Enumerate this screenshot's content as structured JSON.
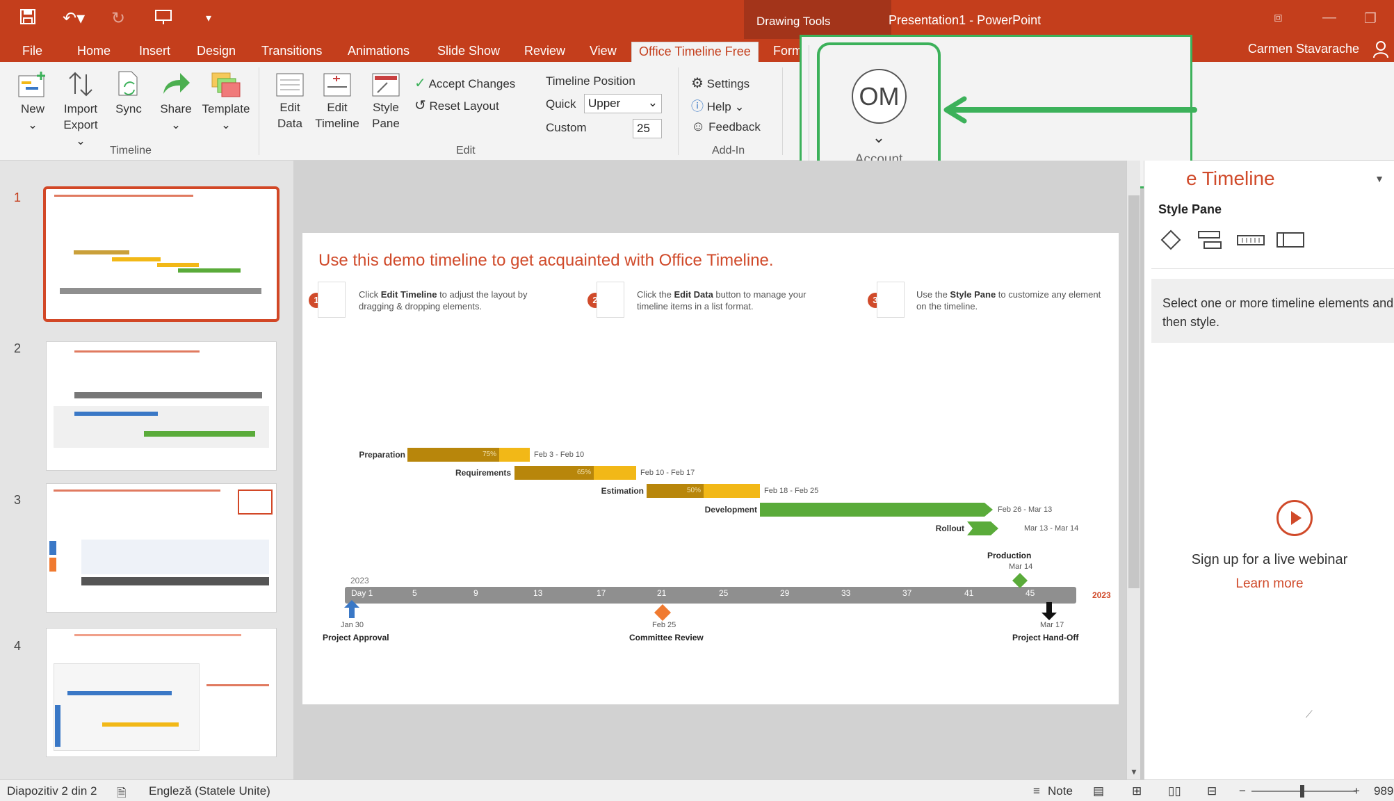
{
  "window": {
    "context_tab": "Drawing Tools",
    "title": "Presentation1 - PowerPoint"
  },
  "tabs": [
    "File",
    "Home",
    "Insert",
    "Design",
    "Transitions",
    "Animations",
    "Slide Show",
    "Review",
    "View",
    "Office Timeline Free",
    "Form"
  ],
  "user": {
    "name": "Carmen Stavarache",
    "initials": "OM",
    "account_label": "Account"
  },
  "ribbon": {
    "timeline_group": {
      "label": "Timeline",
      "new": "New",
      "import": "Import",
      "export": "Export",
      "sync": "Sync",
      "share": "Share",
      "template": "Template"
    },
    "edit_group": {
      "label": "Edit",
      "edit_data_1": "Edit",
      "edit_data_2": "Data",
      "edit_timeline_1": "Edit",
      "edit_timeline_2": "Timeline",
      "style_pane_1": "Style",
      "style_pane_2": "Pane",
      "accept": "Accept Changes",
      "reset": "Reset Layout",
      "timeline_position": "Timeline Position",
      "quick": "Quick",
      "quick_value": "Upper",
      "custom": "Custom",
      "custom_value": "25"
    },
    "addin_group": {
      "label": "Add-In",
      "settings": "Settings",
      "help": "Help",
      "feedback": "Feedback"
    }
  },
  "thumbnails": [
    "1",
    "2",
    "3",
    "4"
  ],
  "slide": {
    "title": "Use this demo timeline to get acquainted with Office Timeline.",
    "steps": [
      {
        "num": "1",
        "pre": "Click ",
        "bold": "Edit Timeline",
        "post": " to adjust the layout by dragging & dropping elements."
      },
      {
        "num": "2",
        "pre": "Click the ",
        "bold": "Edit Data",
        "post": " button to manage your timeline items in a list format."
      },
      {
        "num": "3",
        "pre": "Use the ",
        "bold": "Style Pane",
        "post": " to customize any element on the timeline."
      }
    ],
    "tasks": [
      {
        "name": "Preparation",
        "dates": "Feb 3 - Feb 10",
        "pct": "75%"
      },
      {
        "name": "Requirements",
        "dates": "Feb 10 - Feb 17",
        "pct": "65%"
      },
      {
        "name": "Estimation",
        "dates": "Feb 18 - Feb 25",
        "pct": "50%"
      },
      {
        "name": "Development",
        "dates": "Feb 26 - Mar 13"
      },
      {
        "name": "Rollout",
        "dates": "Mar 13 - Mar 14"
      }
    ],
    "timeline": {
      "year_start": "2023",
      "year_end": "2023",
      "ticks": [
        "Day 1",
        "5",
        "9",
        "13",
        "17",
        "21",
        "25",
        "29",
        "33",
        "37",
        "41",
        "45"
      ]
    },
    "milestones": [
      {
        "name": "Project Approval",
        "date": "Jan 30",
        "color": "#3a78c6"
      },
      {
        "name": "Committee Review",
        "date": "Feb 25",
        "color": "#f07a30"
      },
      {
        "name": "Project Hand-Off",
        "date": "Mar 17",
        "color": "#111111"
      },
      {
        "name": "Production",
        "date": "Mar 14",
        "color": "#5aab3a"
      }
    ]
  },
  "pane": {
    "title": "e Timeline",
    "style_pane": "Style Pane",
    "message": "Select one or more timeline elements and then style.",
    "webinar": "Sign up for a live webinar",
    "learn_more": "Learn more"
  },
  "status": {
    "slide_info": "Diapozitiv 2 din 2",
    "language": "Engleză (Statele Unite)",
    "notes": "Note",
    "zoom": "989"
  },
  "colors": {
    "accent": "#c43e1c",
    "highlight": "#3cb15a",
    "task_gold": "#f2b817",
    "task_green": "#5aab3a"
  }
}
